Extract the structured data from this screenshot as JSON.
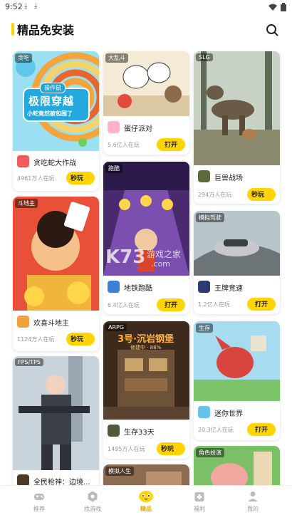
{
  "status": {
    "time": "9:52"
  },
  "header": {
    "title": "精品免安装"
  },
  "columns": [
    [
      {
        "tag": "贪吃",
        "name": "贪吃蛇大作战",
        "players": "4961万人在玩",
        "button": "秒玩",
        "banner_top": "操作鼠",
        "banner_main": "极限穿越",
        "banner_sub": "小蛇竟然被包围了"
      },
      {
        "tag": "斗地主",
        "name": "欢喜斗地主",
        "players": "1124万人在玩",
        "button": "秒玩"
      },
      {
        "tag": "FPS/TPS",
        "name": "全民枪神：边境...",
        "players": "",
        "button": ""
      }
    ],
    [
      {
        "tag": "大乱斗",
        "name": "蛋仔派对",
        "players": "5.6亿人在玩",
        "button": "打开"
      },
      {
        "tag": "跑酷",
        "name": "地铁跑酷",
        "players": "6.4亿人在玩",
        "button": "打开"
      },
      {
        "tag": "ARPG",
        "name": "生存33天",
        "players": "1495万人在玩",
        "button": "秒玩",
        "banner_main": "3号·沉岩钢堡",
        "banner_sub": "修建中 · 88%"
      },
      {
        "tag": "模拟人生",
        "name": "",
        "players": "",
        "button": ""
      }
    ],
    [
      {
        "tag": "SLG",
        "name": "巨兽战场",
        "players": "294万人在玩",
        "button": "秒玩"
      },
      {
        "tag": "模拟驾驶",
        "name": "王牌竞速",
        "players": "1.2亿人在玩",
        "button": "打开"
      },
      {
        "tag": "生存",
        "name": "迷你世界",
        "players": "20.3亿人在玩",
        "button": "打开"
      },
      {
        "tag": "角色扮演",
        "name": "",
        "players": "",
        "button": ""
      }
    ]
  ],
  "watermark": {
    "brand": "K73",
    "text": "游戏之家",
    "domain": ".com"
  },
  "nav": [
    {
      "label": "推荐",
      "icon": "gamepad-icon",
      "active": false
    },
    {
      "label": "找游戏",
      "icon": "compass-icon",
      "active": false
    },
    {
      "label": "精品",
      "icon": "mascot-icon",
      "active": true
    },
    {
      "label": "福利",
      "icon": "gift-icon",
      "active": false
    },
    {
      "label": "我的",
      "icon": "user-icon",
      "active": false
    }
  ],
  "colors": {
    "accent": "#ffd400",
    "active_label": "#e0a800"
  }
}
